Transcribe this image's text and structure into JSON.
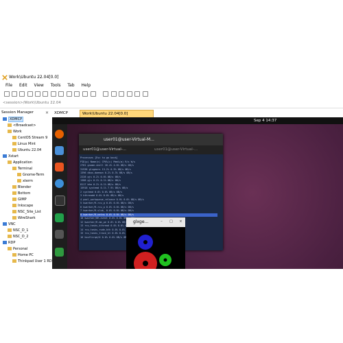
{
  "window": {
    "title": "Work\\Ubuntu 22.04[0.0]"
  },
  "menu": [
    "File",
    "Edit",
    "View",
    "Tools",
    "Tab",
    "Help"
  ],
  "address": "<session>/Work\\Ubuntu 22.04",
  "session_manager": {
    "label": "Session Manager"
  },
  "tree": [
    {
      "label": "XDMCP",
      "indent": 0,
      "selected": true
    },
    {
      "label": "<Broadcast>",
      "indent": 1
    },
    {
      "label": "Work",
      "indent": 1
    },
    {
      "label": "CentOS Stream 9",
      "indent": 2
    },
    {
      "label": "Linux Mint",
      "indent": 2
    },
    {
      "label": "Ubuntu 22.04",
      "indent": 2
    },
    {
      "label": "Xstart",
      "indent": 0
    },
    {
      "label": "Application",
      "indent": 1
    },
    {
      "label": "Terminal",
      "indent": 2
    },
    {
      "label": "Gnome-Term",
      "indent": 3
    },
    {
      "label": "xterm",
      "indent": 3
    },
    {
      "label": "Blender",
      "indent": 2
    },
    {
      "label": "Bottom",
      "indent": 2
    },
    {
      "label": "GIMP",
      "indent": 2
    },
    {
      "label": "Inkscape",
      "indent": 2
    },
    {
      "label": "NSC_Site_List",
      "indent": 2
    },
    {
      "label": "WireShark",
      "indent": 2
    },
    {
      "label": "VNC",
      "indent": 0
    },
    {
      "label": "NSC_D_1",
      "indent": 1
    },
    {
      "label": "NSC_D_2",
      "indent": 1
    },
    {
      "label": "RDP",
      "indent": 0
    },
    {
      "label": "Personal",
      "indent": 1
    },
    {
      "label": "Home PC",
      "indent": 2
    },
    {
      "label": "Thinkpad User 1 RDP",
      "indent": 2
    }
  ],
  "tabs": [
    {
      "label": "XDMCP",
      "active": false
    },
    {
      "label": "Work\\Ubuntu 22.04[0.0]",
      "active": true
    }
  ],
  "remote": {
    "clock": "Sep 4  14:37",
    "terminal_title": "user01@user-Virtual-M...",
    "terminal_tab1": "user01@user-Virtual-...",
    "terminal_tab2": "user01@user-Virtual-...",
    "glx_title": "glxge...",
    "processes": [
      "Processes                                   [Esc to go back]",
      "PID(p)  Name(n)           CPU%(c) Mem%(m)  R/s      W/s",
      "2781    gnome-shell       26.4%   4.6%    0B/s     0B/s",
      "31938   glxgears          13.2%   0.9%    0B/s     0B/s",
      "1396    dbus-daemon       0.2%    0.3%    0B/s     0B/s",
      "2228    gjs               0.2%    0.6%    0B/s     0B/s",
      "1388    gjs               0.2%    0.1%    0B/s     0B/s",
      "8117    btm               0.2%    0.1%    0B/s     0B/s",
      "15918   systemd           0.1%    7.9%    0B/s     0B/s",
      "2       systemd           0.0%    0.0%    0B/s     0B/s",
      "3       kthreadd          0.0%    0.0%    0B/s     0B/s",
      "4       pool_workqueue_release 0.0% 0.0%  0B/s     0B/s",
      "5       kworker/R-rcu_g   0.0%    0.0%    0B/s     0B/s",
      "6       kworker/R-rcu_p   0.0%    0.0%    0B/s     0B/s",
      "7       kworker/R-slub_   0.0%    0.0%    0B/s     0B/s",
      "8       kworker/R-netns   0.0%    0.0%    0B/s     0B/s",
      "10      kworker/0H-event  0.0%    0.0%    0B/s     0B/s",
      "12      kworker/R-mm_pe   0.0%    0.0%    0B/s     0B/s",
      "13      rcu_tasks_kthread 0.0%    0.0%    0B/s     0B/s",
      "14      rcu_tasks_rude_kth 0.0%   0.0%    0B/s     0B/s",
      "15      rcu_tasks_trace_kt 0.0%   0.0%    0B/s     0B/s",
      "16      ksoftirqd/0       0.0%    0.0%    0B/s     0B/s"
    ]
  }
}
